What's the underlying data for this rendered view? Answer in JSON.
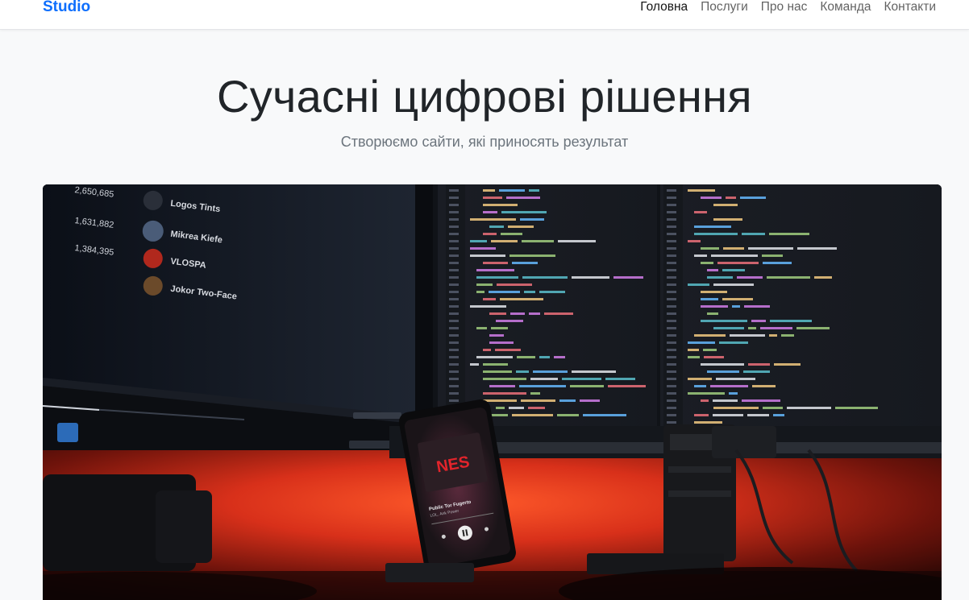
{
  "navbar": {
    "brand": "Studio",
    "links": [
      {
        "label": "Головна",
        "active": true
      },
      {
        "label": "Послуги",
        "active": false
      },
      {
        "label": "Про нас",
        "active": false
      },
      {
        "label": "Команда",
        "active": false
      },
      {
        "label": "Контакти",
        "active": false
      }
    ]
  },
  "hero": {
    "title": "Сучасні цифрові рішення",
    "subtitle": "Створюємо сайти, які приносять результат"
  },
  "photo": {
    "playlist": [
      {
        "count": "2,650,685",
        "name": "Logos Tints"
      },
      {
        "count": "1,631,882",
        "name": "Mikrea Kiefe"
      },
      {
        "count": "1,384,395",
        "name": "VLOSPA"
      },
      {
        "count": "",
        "name": "Jokor Two-Face"
      }
    ],
    "phone_track": "Public Tor Fugerto",
    "phone_artist": "LOL, Ank Power",
    "phone_logo": "NES"
  },
  "colors": {
    "brand": "#0d6efd",
    "glow": "#ff3b1f"
  }
}
